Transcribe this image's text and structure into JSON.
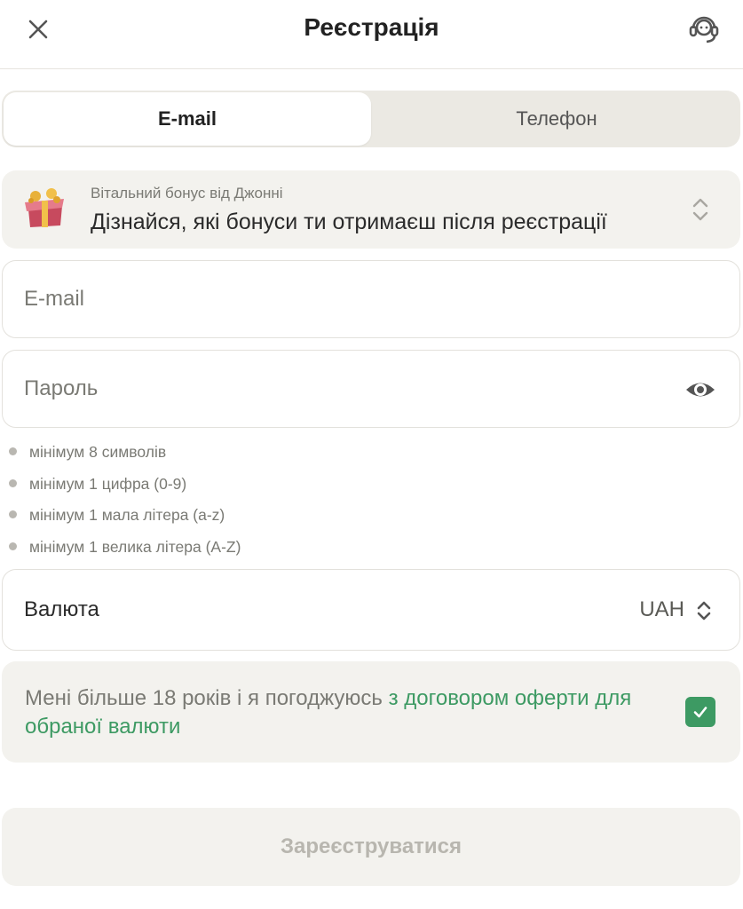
{
  "header": {
    "title": "Реєстрація",
    "close_icon": "close-icon",
    "support_icon": "headset-icon"
  },
  "tabs": [
    {
      "label": "E-mail",
      "active": true
    },
    {
      "label": "Телефон",
      "active": false
    }
  ],
  "bonus": {
    "subtitle": "Вітальний бонус від Джонні",
    "title": "Дізнайся, які бонуси ти отримаєш після реєстрації",
    "icon": "gift-box-icon"
  },
  "form": {
    "email_placeholder": "E-mail",
    "email_value": "",
    "password_placeholder": "Пароль",
    "password_value": "",
    "password_toggle_icon": "eye-icon"
  },
  "password_rules": [
    "мінімум 8 символів",
    "мінімум 1 цифра (0-9)",
    "мінімум 1 мала літера (a-z)",
    "мінімум 1 велика літера (A-Z)"
  ],
  "currency": {
    "label": "Валюта",
    "value": "UAH"
  },
  "agreement": {
    "text": "Мені більше 18 років і я погоджуюсь ",
    "link": "з договором оферти для обраної валюти",
    "checked": true
  },
  "submit_label": "Зареєструватися",
  "colors": {
    "accent": "#3d9a63",
    "panel": "#f3f2ee",
    "tab_bar": "#ebe9e3",
    "muted_text": "#7a7a74",
    "disabled_text": "#b8b6af"
  }
}
